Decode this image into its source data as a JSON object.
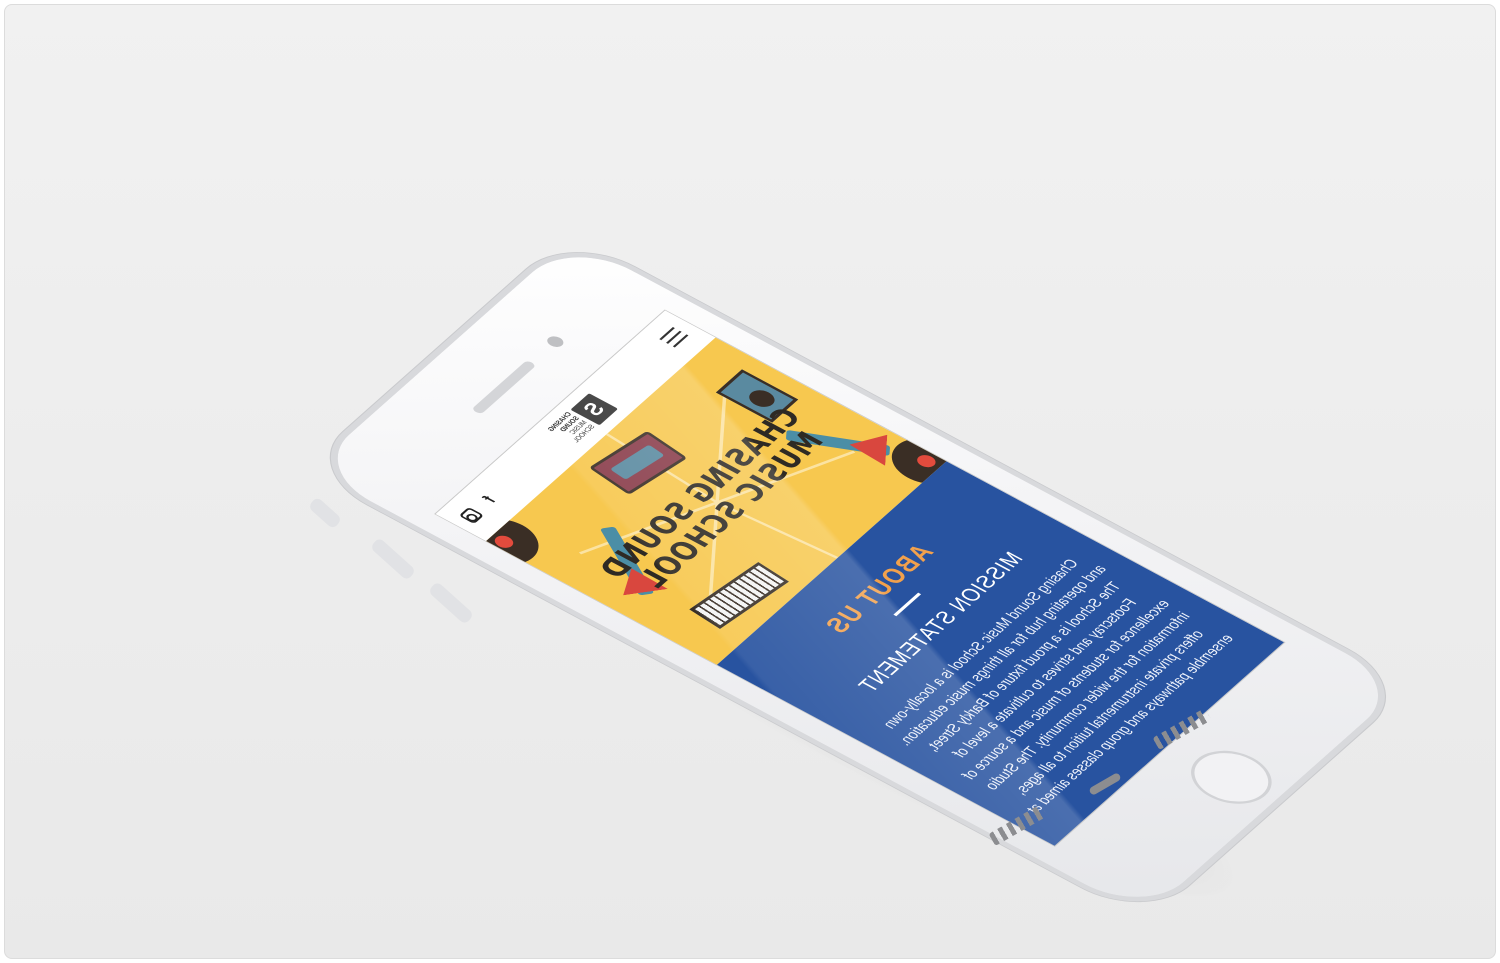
{
  "header": {
    "menu_icon": "hamburger-icon",
    "logo_line1": "CHASING",
    "logo_line2": "SOUND",
    "logo_line3": "MUSIC",
    "logo_line4": "SCHOOL",
    "facebook_icon": "facebook-icon",
    "facebook_glyph": "f",
    "instagram_icon": "instagram-icon"
  },
  "hero": {
    "title_line1": "CHASING SOUND",
    "title_line2": "MUSIC SCHOOL",
    "background_color": "#f7c84f"
  },
  "about": {
    "heading": "ABOUT US",
    "subheading": "MISSION STATEMENT",
    "body": "Chasing Sound Music School is a locally-own and operating hub for all things music education. The School is a proud fixture of Barkly Street, Footscray and strives to cultivate a level of excellence for students of music and a source of information for the wider community. The Studio offers private instrumental tuition to all ages, ensemble pathways and group classes aimed at",
    "background_color": "#2853a0",
    "heading_color": "#f2a14c"
  }
}
